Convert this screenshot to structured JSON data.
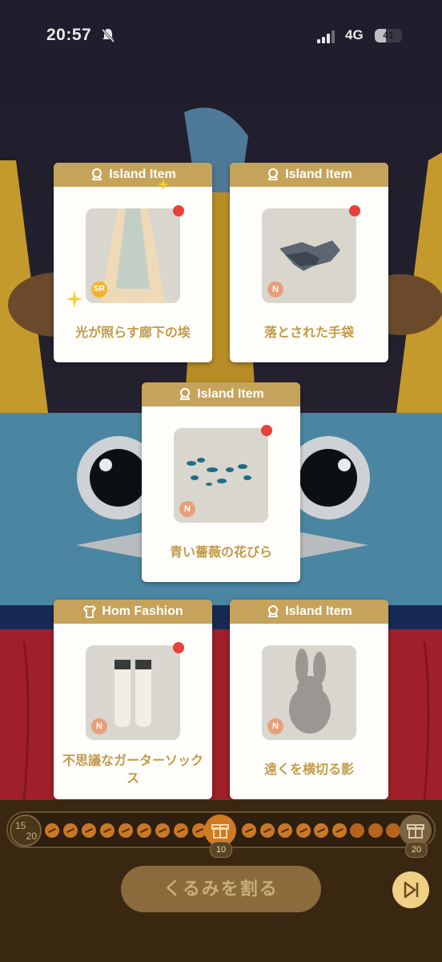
{
  "status_bar": {
    "time": "20:57",
    "network": "4G",
    "battery": "41"
  },
  "cards": [
    {
      "category": "Island Item",
      "icon": "island-icon",
      "name": "光が照らす廊下の埃",
      "rarity": "SR",
      "is_new": true
    },
    {
      "category": "Island Item",
      "icon": "island-icon",
      "name": "落とされた手袋",
      "rarity": "N",
      "is_new": true
    },
    {
      "category": "Island Item",
      "icon": "island-icon",
      "name": "青い薔薇の花びら",
      "rarity": "N",
      "is_new": true
    },
    {
      "category": "Hom Fashion",
      "icon": "shirt-icon",
      "name": "不思議なガーターソックス",
      "rarity": "N",
      "is_new": true
    },
    {
      "category": "Island Item",
      "icon": "island-icon",
      "name": "遠くを横切る影",
      "rarity": "N",
      "is_new": false
    }
  ],
  "progress": {
    "current": "15",
    "total": "20",
    "milestone_1": "10",
    "milestone_2": "20",
    "cracked_count": 15
  },
  "actions": {
    "crack_label": "くるみを割る",
    "skip_icon": "skip-icon"
  },
  "colors": {
    "card_header": "#c6a35a",
    "card_name": "#c39a4a",
    "new_dot": "#e8403a",
    "rarity_n": "#e6a07c",
    "rarity_sr": "#f2b52a"
  }
}
